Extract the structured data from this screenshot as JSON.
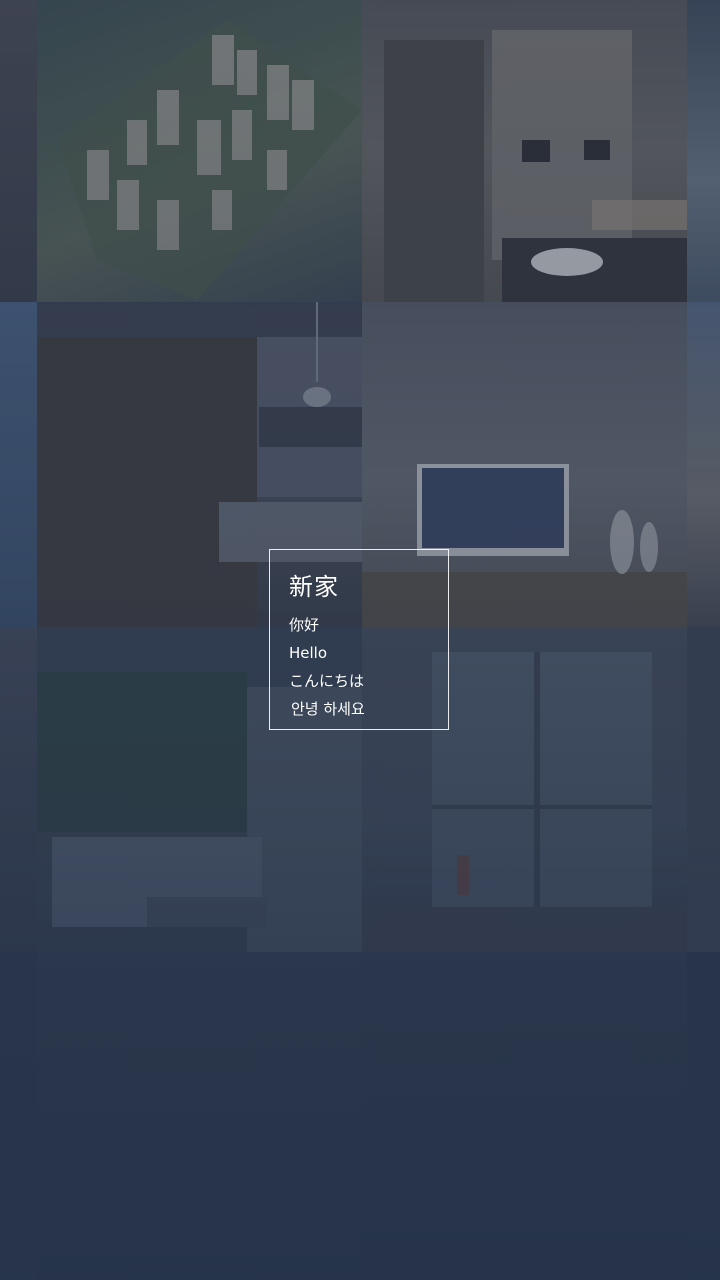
{
  "greeting": {
    "title": "新家",
    "lines": [
      "你好",
      "Hello",
      "こんにちは",
      "안녕 하세요"
    ]
  },
  "colors": {
    "background": "#26334a",
    "border": "#ffffff",
    "text": "#ffffff"
  },
  "tiles": [
    {
      "name": "aerial-residential-complex-photo"
    },
    {
      "name": "bathroom-vanity-photo"
    },
    {
      "name": "kitchen-counter-photo"
    },
    {
      "name": "living-room-tv-photo"
    },
    {
      "name": "bedroom-sofa-photo"
    },
    {
      "name": "window-room-photo"
    },
    {
      "name": "aerial-complex-photo-faded"
    },
    {
      "name": "bathroom-photo-faded"
    }
  ]
}
